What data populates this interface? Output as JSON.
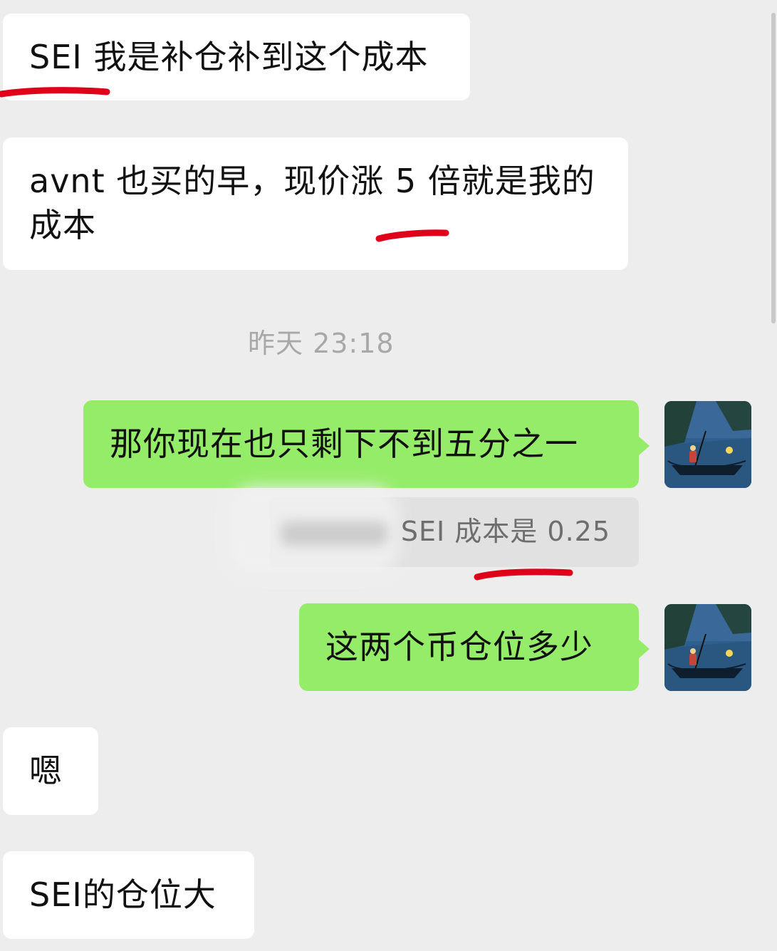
{
  "messages": [
    {
      "side": "left",
      "text": "SEI 我是补仓补到这个成本"
    },
    {
      "side": "left",
      "text": "avnt 也买的早，现价涨 5 倍就是我的成本"
    },
    {
      "side": "right",
      "text": "那你现在也只剩下不到五分之一",
      "quote": "SEI 成本是 0.25"
    },
    {
      "side": "right",
      "text": "这两个币仓位多少"
    },
    {
      "side": "left",
      "text": "嗯"
    },
    {
      "side": "left",
      "text": "SEI的仓位大"
    }
  ],
  "timestamp": "昨天 23:18",
  "colors": {
    "background": "#ededed",
    "bubble_left": "#ffffff",
    "bubble_right": "#95ec69",
    "underline": "#e0001a",
    "text": "#111111",
    "timestamp": "#a8a8a8"
  },
  "icons": {
    "avatar": "avatar-boat-night-icon"
  }
}
